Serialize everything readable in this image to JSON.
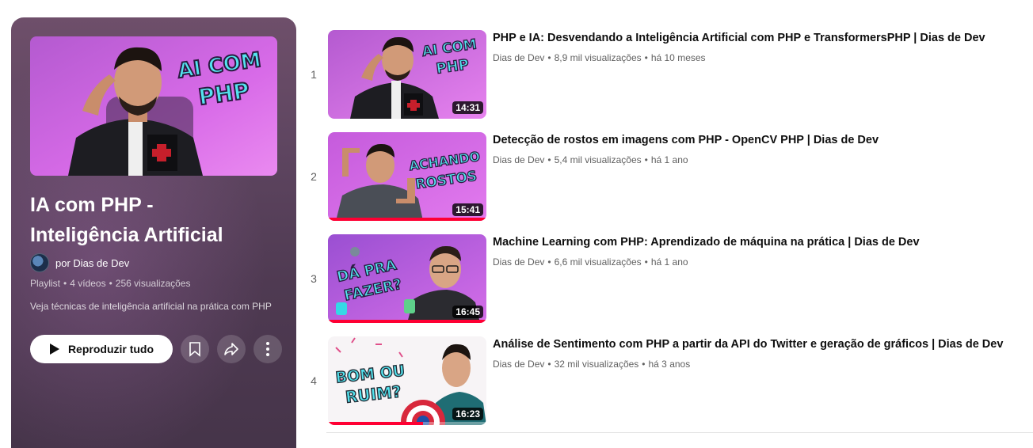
{
  "playlist": {
    "title_line1": "IA com PHP -",
    "title_line2": "Inteligência Artificial",
    "owner": "por Dias de Dev",
    "type": "Playlist",
    "video_count": "4 vídeos",
    "views": "256 visualizações",
    "description": "Veja técnicas de inteligência artificial na prática com PHP",
    "hero_text_line1": "AI COM",
    "hero_text_line2": "PHP"
  },
  "actions": {
    "play_all_label": "Reproduzir tudo",
    "save_icon": "bookmark-icon",
    "share_icon": "share-icon",
    "more_icon": "more-vertical-icon"
  },
  "videos": [
    {
      "index": "1",
      "title": "PHP e IA: Desvendando a Inteligência Artificial com PHP e TransformersPHP | Dias de Dev",
      "channel": "Dias de Dev",
      "views": "8,9 mil visualizações",
      "age": "há 10 meses",
      "duration": "14:31",
      "thumb_text_line1": "AI COM",
      "thumb_text_line2": "PHP",
      "progress": 0
    },
    {
      "index": "2",
      "title": "Detecção de rostos em imagens com PHP - OpenCV PHP | Dias de Dev",
      "channel": "Dias de Dev",
      "views": "5,4 mil visualizações",
      "age": "há 1 ano",
      "duration": "15:41",
      "thumb_text_line1": "ACHANDO",
      "thumb_text_line2": "ROSTOS",
      "progress": 1
    },
    {
      "index": "3",
      "title": "Machine Learning com PHP: Aprendizado de máquina na prática | Dias de Dev",
      "channel": "Dias de Dev",
      "views": "6,6 mil visualizações",
      "age": "há 1 ano",
      "duration": "16:45",
      "thumb_text_line1": "DÁ PRA",
      "thumb_text_line2": "FAZER?",
      "progress": 1
    },
    {
      "index": "4",
      "title": "Análise de Sentimento com PHP a partir da API do Twitter e geração de gráficos | Dias de Dev",
      "channel": "Dias de Dev",
      "views": "32 mil visualizações",
      "age": "há 3 anos",
      "duration": "16:23",
      "thumb_text_line1": "BOM OU",
      "thumb_text_line2": "RUIM?",
      "progress": 0.6
    }
  ],
  "colors": {
    "progress": "#ff0033",
    "panel": "#5e4560",
    "thumb_magenta": "#d94be6",
    "thumb_cyan": "#35d8e6"
  }
}
